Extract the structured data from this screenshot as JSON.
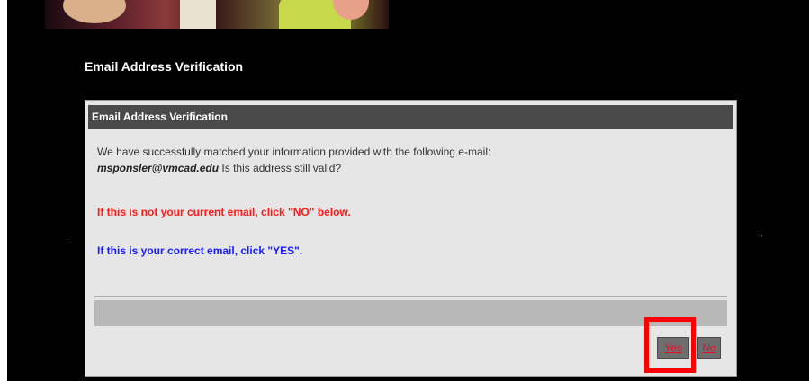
{
  "page": {
    "heading": "Email Address Verification"
  },
  "dialog": {
    "title": "Email Address Verification",
    "intro_text": "We have successfully matched your information provided with the following e-mail:",
    "email": "msponsler@vmcad.edu",
    "question_text": " Is this address still valid?",
    "warning_text": "If this is not your current email, click \"NO\" below.",
    "confirm_text": "If this is your correct email, click \"YES\"."
  },
  "buttons": {
    "yes_label": "Yes",
    "no_label": "No"
  },
  "colors": {
    "background": "#000000",
    "dialog_bg": "#e6e6e6",
    "header_bg": "#4a4a4a",
    "warning": "#ff1a1a",
    "confirm": "#1a1aff",
    "button_text": "#e0102a",
    "highlight": "#ff0000"
  }
}
